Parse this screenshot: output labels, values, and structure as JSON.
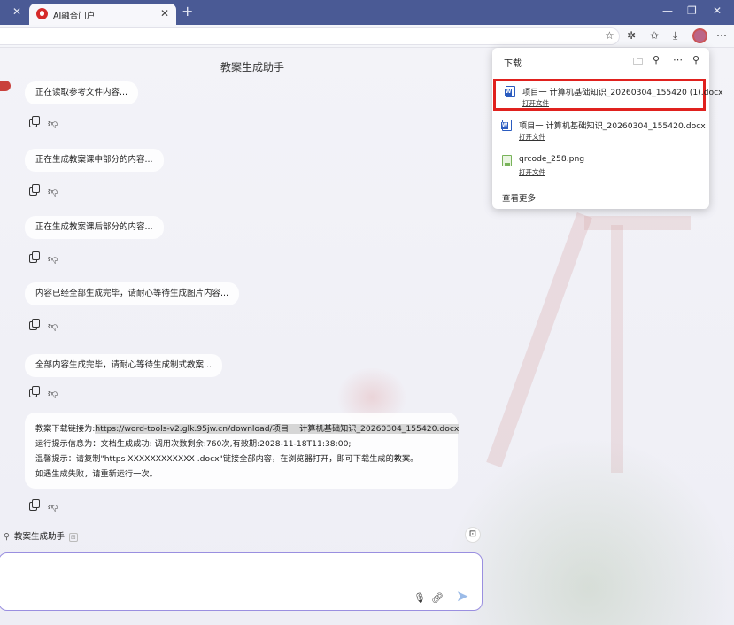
{
  "browser": {
    "tab_title": "AI融合门户",
    "new_tab_symbol": "+",
    "close_symbol": "✕"
  },
  "page": {
    "title": "教案生成助手",
    "messages": [
      "正在读取参考文件内容...",
      "正在生成教案课中部分的内容...",
      "正在生成教案课后部分的内容...",
      "内容已经全部生成完毕，请耐心等待生成图片内容...",
      "全部内容生成完毕，请耐心等待生成制式教案..."
    ],
    "final_message": {
      "link_label": "教案下载链接为:",
      "link_url": "https://word-tools-v2.glk.95jw.cn/download/项目一 计算机基础知识_20260304_155420.docx",
      "status_line": "运行提示信息为：文档生成成功: 调用次数剩余:760次,有效期:2028-11-18T11:38:00;",
      "tip_line": "温馨提示：请复制\"https XXXXXXXXXXXX .docx\"链接全部内容，在浏览器打开，即可下载生成的教案。",
      "retry_line": "如遇生成失败，请重新运行一次。"
    },
    "agent_chip_label": "教案生成助手",
    "agent_chip_badge": "⊞"
  },
  "downloads": {
    "title": "下载",
    "items": [
      {
        "name": "项目一 计算机基础知识_20260304_155420 (1).docx",
        "action": "打开文件",
        "type": "docx"
      },
      {
        "name": "项目一 计算机基础知识_20260304_155420.docx",
        "action": "打开文件",
        "type": "docx"
      },
      {
        "name": "qrcode_258.png",
        "action": "打开文件",
        "type": "png"
      }
    ],
    "see_more": "查看更多"
  },
  "colors": {
    "titlebar": "#4a5a95",
    "highlight_border": "#e0211e",
    "composer_border": "#9a8fe0"
  }
}
